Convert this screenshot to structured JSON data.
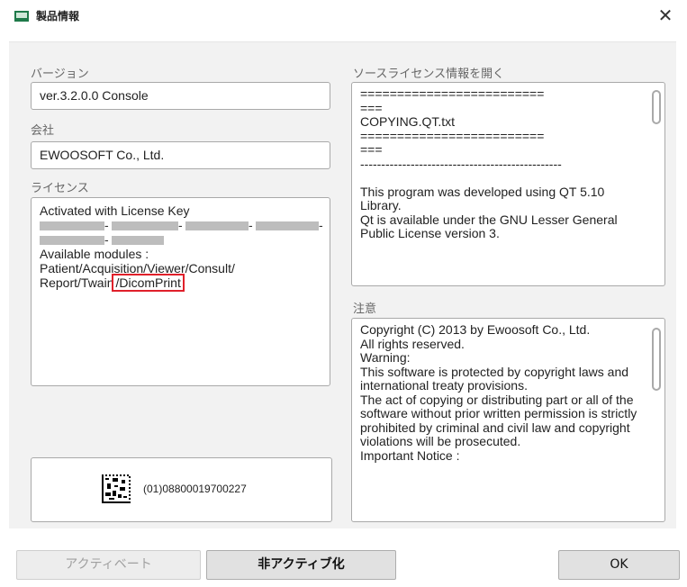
{
  "window": {
    "title": "製品情報",
    "close_glyph": "✕"
  },
  "version": {
    "label": "バージョン",
    "value": "ver.3.2.0.0 Console"
  },
  "company": {
    "label": "会社",
    "value": "EWOOSOFT Co., Ltd."
  },
  "license": {
    "label": "ライセンス",
    "line1": "Activated with License Key",
    "dash": "-",
    "modules_line1": "Available modules :",
    "modules_line2": "Patient/Acquisition/Viewer/Consult/",
    "modules_line3_prefix": "Report/Twain",
    "modules_line3_highlight": "/DicomPrint"
  },
  "barcode": {
    "text": "(01)08800019700227"
  },
  "source_license": {
    "label": "ソースライセンス情報を開く",
    "text": "=========================\n===\nCOPYING.QT.txt\n=========================\n===\n------------------------------------------------\n\nThis program was developed using QT 5.10 Library.\nQt is available under the GNU Lesser General Public License version 3."
  },
  "notice": {
    "label": "注意",
    "text": "Copyright (C) 2013 by Ewoosoft Co., Ltd.\nAll rights reserved.\nWarning:\nThis software is protected by copyright laws and international treaty provisions.\nThe act of copying or distributing part or all of the software without prior written permission is strictly prohibited by criminal and civil law and copyright violations will be prosecuted.\nImportant Notice :"
  },
  "buttons": {
    "activate": "アクティベート",
    "deactivate": "非アクティブ化",
    "ok": "OK"
  },
  "icons": {
    "app": "app-icon",
    "close": "close-icon",
    "qr": "datamatrix-icon"
  },
  "colors": {
    "highlight_border": "#e0202a",
    "panel_bg": "#f2f2f2"
  }
}
